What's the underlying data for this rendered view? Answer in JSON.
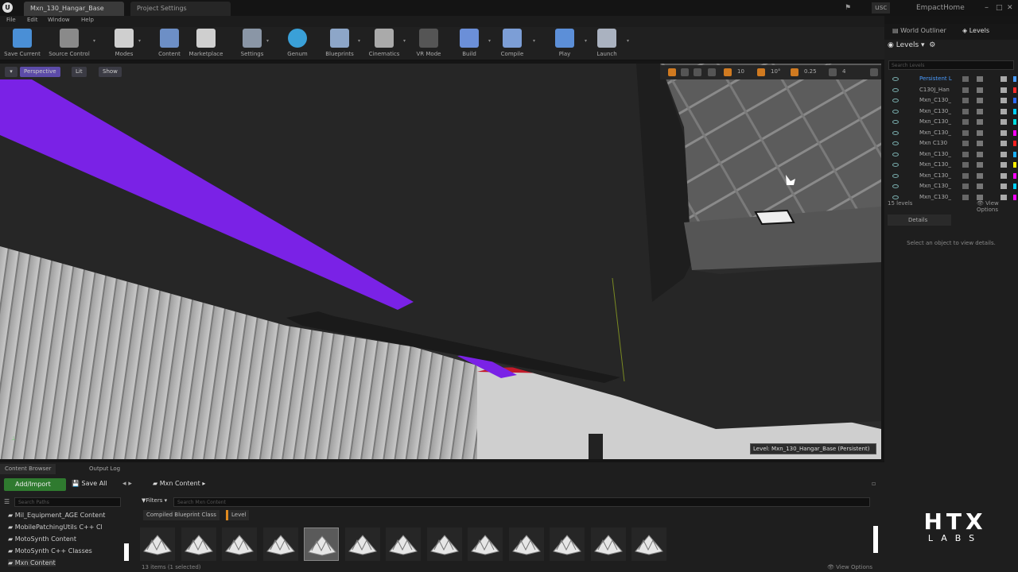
{
  "window": {
    "tabs": [
      "Mxn_130_Hangar_Base",
      "Project Settings"
    ],
    "right_label": "EmpactHome",
    "user_chip": "usc"
  },
  "menubar": [
    "File",
    "Edit",
    "Window",
    "Help"
  ],
  "toolbar": [
    {
      "label": "Save Current",
      "icon": "save-icon",
      "color": "#4a8fd6"
    },
    {
      "label": "Source Control",
      "icon": "source-control-icon",
      "color": "#8a8a8a"
    },
    {
      "label": "Modes",
      "icon": "modes-icon",
      "color": "#cfcfcf"
    },
    {
      "label": "Content",
      "icon": "content-icon",
      "color": "#6d8fc6"
    },
    {
      "label": "Marketplace",
      "icon": "marketplace-icon",
      "color": "#cfcfcf"
    },
    {
      "label": "Settings",
      "icon": "settings-icon",
      "color": "#8a96a6"
    },
    {
      "label": "Genum",
      "icon": "genum-icon",
      "color": "#3aa0d8"
    },
    {
      "label": "Blueprints",
      "icon": "blueprints-icon",
      "color": "#8da6c8"
    },
    {
      "label": "Cinematics",
      "icon": "cinematics-icon",
      "color": "#aaaaaa"
    },
    {
      "label": "VR Mode",
      "icon": "vr-mode-icon",
      "color": "#555555"
    },
    {
      "label": "Build",
      "icon": "build-icon",
      "color": "#6b8fd8"
    },
    {
      "label": "Compile",
      "icon": "compile-icon",
      "color": "#7c9ed6"
    },
    {
      "label": "Play",
      "icon": "play-icon",
      "color": "#5c8fd8"
    },
    {
      "label": "Launch",
      "icon": "launch-icon",
      "color": "#aab2c0"
    }
  ],
  "viewport": {
    "perspective_label": "Perspective",
    "lit_label": "Lit",
    "show_label": "Show",
    "snap_values": [
      "10",
      "10°",
      "0.25",
      "4"
    ],
    "level_label": "Level: Mxn_130_Hangar_Base (Persistent)"
  },
  "right_panel": {
    "tabs": [
      "World Outliner",
      "Levels"
    ],
    "header": "Levels",
    "search_placeholder": "Search Levels",
    "levels": [
      {
        "name": "Persistent L",
        "color": "#4a9cff"
      },
      {
        "name": "C130J_Han",
        "color": "#ff2d2d"
      },
      {
        "name": "Mxn_C130_",
        "color": "#2d6bff"
      },
      {
        "name": "Mxn_C130_",
        "color": "#00d0ff"
      },
      {
        "name": "Mxn_C130_",
        "color": "#00e0e0"
      },
      {
        "name": "Mxn_C130_",
        "color": "#ff00ff"
      },
      {
        "name": "Mxn C130",
        "color": "#ff2020"
      },
      {
        "name": "Mxn_C130_",
        "color": "#1ab0ff"
      },
      {
        "name": "Mxn_C130_",
        "color": "#ffee00"
      },
      {
        "name": "Mxn_C130_",
        "color": "#ff00ff"
      },
      {
        "name": "Mxn_C130_",
        "color": "#00d0ff"
      },
      {
        "name": "Mxn_C130_",
        "color": "#ff00ff"
      }
    ],
    "levels_count": "15 levels",
    "view_options": "View Options",
    "details_tab": "Details",
    "details_message": "Select an object to view details."
  },
  "content_browser": {
    "tabs": [
      "Content Browser",
      "Output Log"
    ],
    "add_import": "Add/Import",
    "save_all": "Save All",
    "path": "Mxn Content",
    "search_paths": "Search Paths",
    "filters": "Filters",
    "search_placeholder": "Search Mxn Content",
    "filter_chips": [
      "Compiled Blueprint Class",
      "Level"
    ],
    "tree": [
      "Mil_Equipment_AGE Content",
      "MobilePatchingUtils C++ Cl",
      "MotoSynth Content",
      "MotoSynth C++ Classes",
      "Mxn Content"
    ],
    "status": "13 items (1 selected)",
    "view_options": "View Options"
  },
  "watermark": {
    "line1": "HTX",
    "line2": "LABS"
  }
}
